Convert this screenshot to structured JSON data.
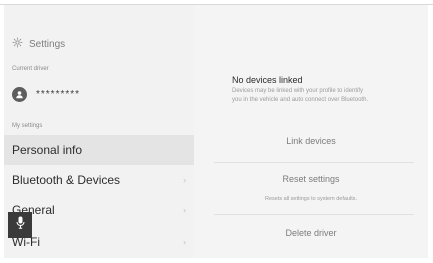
{
  "sidebar": {
    "header_title": "Settings",
    "current_driver_label": "Current driver",
    "driver_name": "*********",
    "my_settings_label": "My settings",
    "items": [
      {
        "label": "Personal info",
        "selected": true
      },
      {
        "label": "Bluetooth & Devices"
      },
      {
        "label": "General"
      },
      {
        "label": "Wi-Fi"
      }
    ]
  },
  "main": {
    "no_devices_title": "No devices linked",
    "no_devices_desc": "Devices may be linked with your profile to identify you in the vehicle and auto connect over Bluetooth.",
    "link_devices_label": "Link devices",
    "reset_settings_label": "Reset settings",
    "reset_settings_desc": "Resets all settings to system defaults.",
    "delete_driver_label": "Delete driver"
  },
  "icons": {
    "settings": "gear-icon",
    "avatar": "person-icon",
    "chevron": "chevron-right-icon",
    "voice": "microphone-icon"
  },
  "colors": {
    "selected_row": "#e4e4e4",
    "voice_button": "#3a3a3a"
  }
}
